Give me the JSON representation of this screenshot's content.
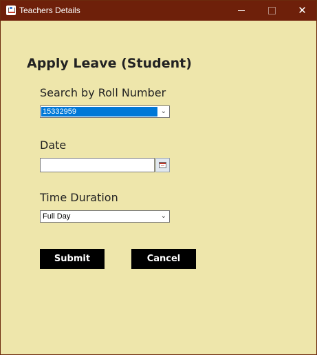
{
  "window": {
    "title": "Teachers Details",
    "controls": {
      "minimize": "minimize",
      "maximize": "maximize",
      "close": "✕"
    }
  },
  "form": {
    "heading": "Apply Leave (Student)",
    "roll_label": "Search by Roll Number",
    "roll_value": "15332959",
    "date_label": "Date",
    "date_value": "",
    "time_label": "Time Duration",
    "time_value": "Full Day",
    "submit_label": "Submit",
    "cancel_label": "Cancel"
  },
  "icons": {
    "app": "java-app-icon",
    "calendar": "calendar-icon",
    "dropdown": "chevron-down-icon"
  },
  "colors": {
    "titlebar": "#6e200a",
    "background": "#eee6ab",
    "selection": "#0078d7",
    "button": "#000000"
  }
}
